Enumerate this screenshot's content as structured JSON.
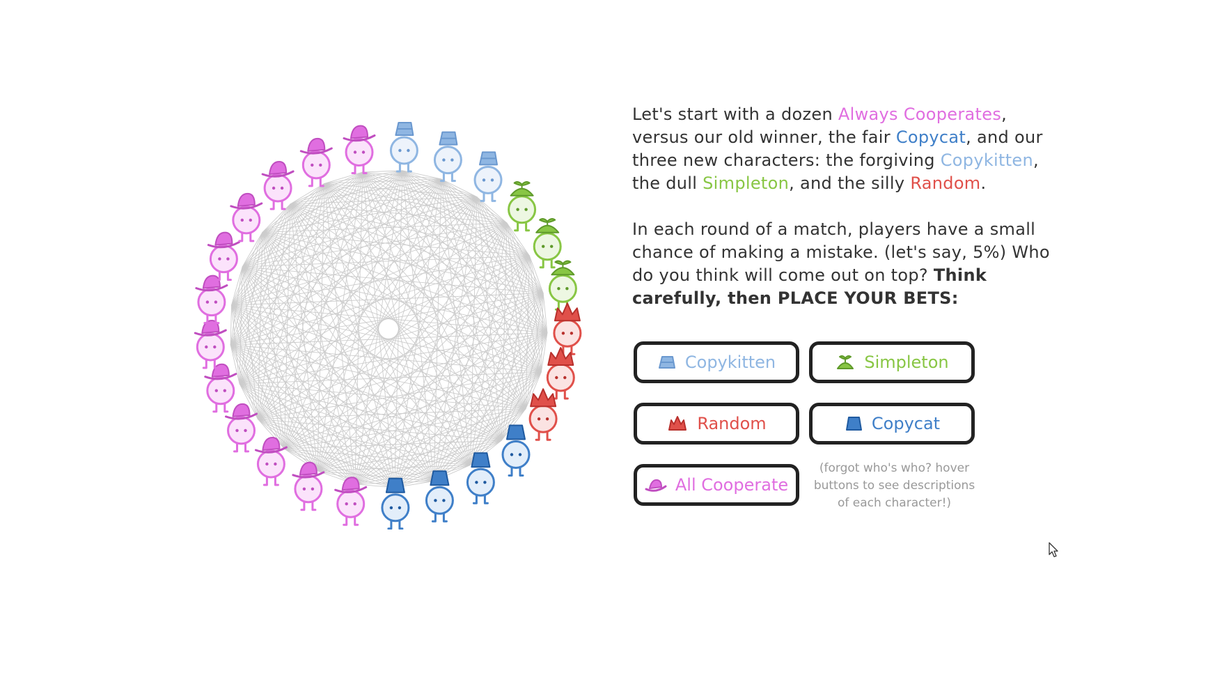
{
  "colors": {
    "always_cooperate": "#e06ee0",
    "copycat": "#3f7fc8",
    "copykitten": "#8fb6e2",
    "simpleton": "#88c644",
    "random": "#e0504a",
    "text": "#333333",
    "hint": "#999999",
    "web": "#cccccc"
  },
  "scene": {
    "counts": {
      "copykitten": 3,
      "simpleton": 3,
      "random": 3,
      "copycat": 4,
      "always_cooperate": 12
    },
    "hat_icons": {
      "copykitten": "light-blue-bucket-hat-icon",
      "simpleton": "propeller-cap-icon",
      "random": "jester-hat-icon",
      "copycat": "blue-fez-icon",
      "always_cooperate": "pink-cowboy-hat-icon"
    }
  },
  "intro": {
    "s1_a": "Let's start with a dozen ",
    "s1_always": "Always Cooperates",
    "s1_b": ", versus our old winner, the fair ",
    "s1_copycat": "Copycat",
    "s1_c": ", and our three new characters: the forgiving ",
    "s1_copykitten": "Copykitten",
    "s1_d": ", the dull ",
    "s1_simpleton": "Simpleton",
    "s1_e": ", and the silly ",
    "s1_random": "Random",
    "s1_f": ".",
    "s2_a": "In each round of a match, players have a small chance of making a mistake. (let's say, 5%) Who do you think will come out on top? ",
    "s2_bold": "Think carefully, then PLACE YOUR BETS:"
  },
  "buttons": {
    "copykitten": "Copykitten",
    "simpleton": "Simpleton",
    "random": "Random",
    "copycat": "Copycat",
    "all_cooperate": "All Cooperate"
  },
  "hint_text": "(forgot who's who? hover buttons to see descriptions of each character!)"
}
